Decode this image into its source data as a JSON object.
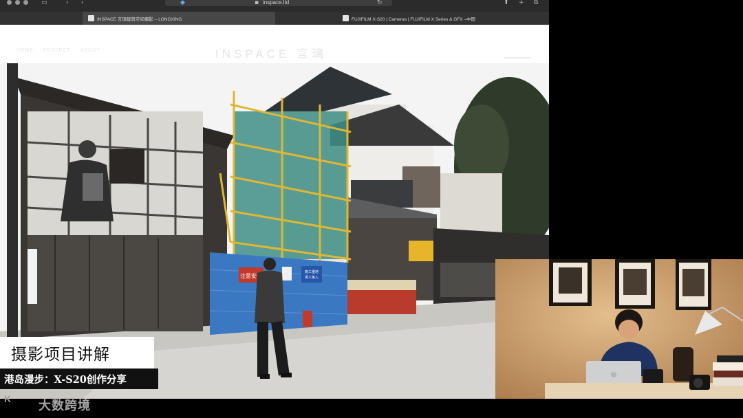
{
  "browser": {
    "url": "inspace.ltd",
    "tabs": [
      {
        "label": "INSPACE 言璃建筑空间摄影 – LONGXING",
        "active": true
      },
      {
        "label": "FUJIFILM X-S20 | Cameras | FUJIFILM X Series & GFX –中国",
        "active": false
      }
    ]
  },
  "site": {
    "logo": "INSPACE 言璃",
    "nav": [
      "HOME",
      "PROJECT",
      "ABOUT"
    ]
  },
  "photo": {
    "signs": [
      "注意安全",
      "施工重地",
      "闲人免入"
    ]
  },
  "overlay": {
    "title": "摄影项目讲解",
    "subtitle": "港岛漫步：X-S20创作分享"
  },
  "watermark": {
    "logo": "K",
    "text": "大数跨境"
  },
  "colors": {
    "scaffold_net": "#3e8e86",
    "hoarding_blue": "#3a78c2",
    "sign_red": "#c23a2a",
    "cam_wall": "#d4a877"
  }
}
